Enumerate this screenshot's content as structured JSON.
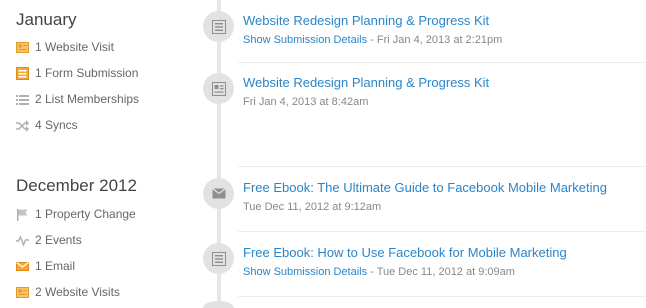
{
  "months": [
    {
      "title": "January",
      "summary": [
        {
          "icon": "website-visit-icon",
          "label": "1 Website Visit"
        },
        {
          "icon": "form-submission-icon",
          "label": "1 Form Submission"
        },
        {
          "icon": "list-icon",
          "label": "2 List Memberships"
        },
        {
          "icon": "sync-icon",
          "label": "4 Syncs"
        }
      ]
    },
    {
      "title": "December 2012",
      "summary": [
        {
          "icon": "flag-icon",
          "label": "1 Property Change"
        },
        {
          "icon": "events-icon",
          "label": "2 Events"
        },
        {
          "icon": "email-icon",
          "label": "1 Email"
        },
        {
          "icon": "website-visit-icon",
          "label": "2 Website Visits"
        }
      ]
    }
  ],
  "events": [
    {
      "icon": "form-icon",
      "title": "Website Redesign Planning & Progress Kit",
      "link": "Show Submission Details",
      "meta": " - Fri Jan 4, 2013 at 2:21pm"
    },
    {
      "icon": "page-icon",
      "title": "Website Redesign Planning & Progress Kit",
      "meta": "Fri Jan 4, 2013 at 8:42am"
    },
    {
      "icon": "envelope-icon",
      "title": "Free Ebook: The Ultimate Guide to Facebook Mobile Marketing",
      "meta": "Tue Dec 11, 2012 at 9:12am"
    },
    {
      "icon": "form-icon",
      "title": "Free Ebook: How to Use Facebook for Mobile Marketing",
      "link": "Show Submission Details",
      "meta": " - Tue Dec 11, 2012 at 9:09am"
    }
  ],
  "colors": {
    "accent": "#2a85c8",
    "icon_orange": "#f0a030",
    "icon_grey": "#b0b0b0",
    "node_bg": "#e2e2e2"
  }
}
